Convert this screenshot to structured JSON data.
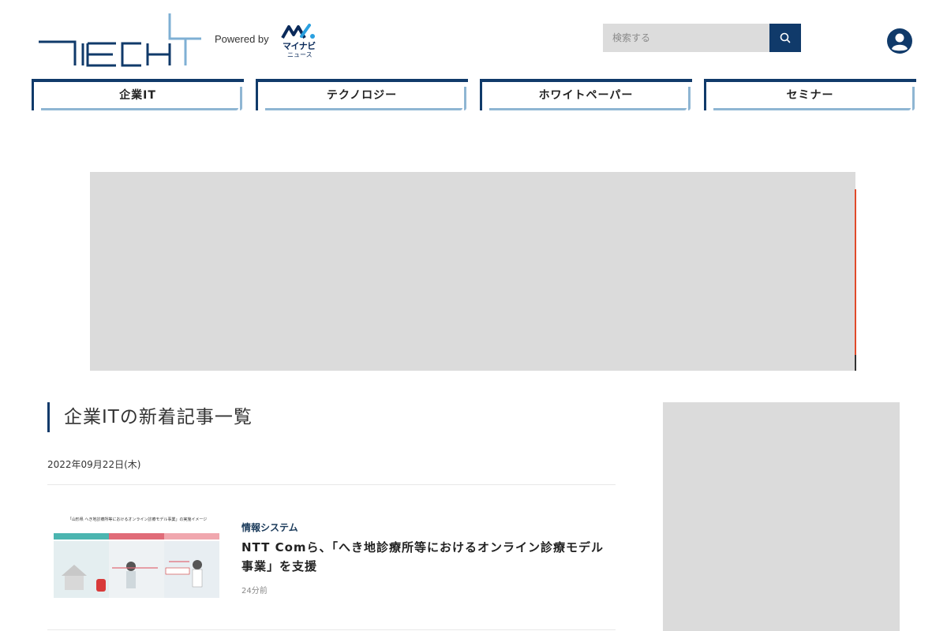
{
  "header": {
    "logo_alt": "TECH+",
    "powered_by": "Powered by",
    "mynavi_logo_text": "マイナビ",
    "mynavi_logo_sub": "ニュース",
    "search": {
      "placeholder": "検索する"
    }
  },
  "nav": {
    "tabs": [
      {
        "label": "企業IT"
      },
      {
        "label": "テクノロジー"
      },
      {
        "label": "ホワイトペーパー"
      },
      {
        "label": "セミナー"
      }
    ]
  },
  "section": {
    "title": "企業ITの新着記事一覧",
    "date": "2022年09月22日(木)"
  },
  "articles": [
    {
      "category": "情報システム",
      "title": "NTT Comら、「へき地診療所等におけるオンライン診療モデル事業」を支援",
      "time": "24分前",
      "thumbnail_caption": "「山形県 へき地診療所等におけるオンライン診療モデル事業」の実施イメージ"
    }
  ],
  "colors": {
    "brand_navy": "#103a6a",
    "tab_accent": "#8fb6d3",
    "ad_placeholder": "#dbdbdb"
  },
  "icons": {
    "search": "search-icon",
    "user": "user-account-icon"
  }
}
